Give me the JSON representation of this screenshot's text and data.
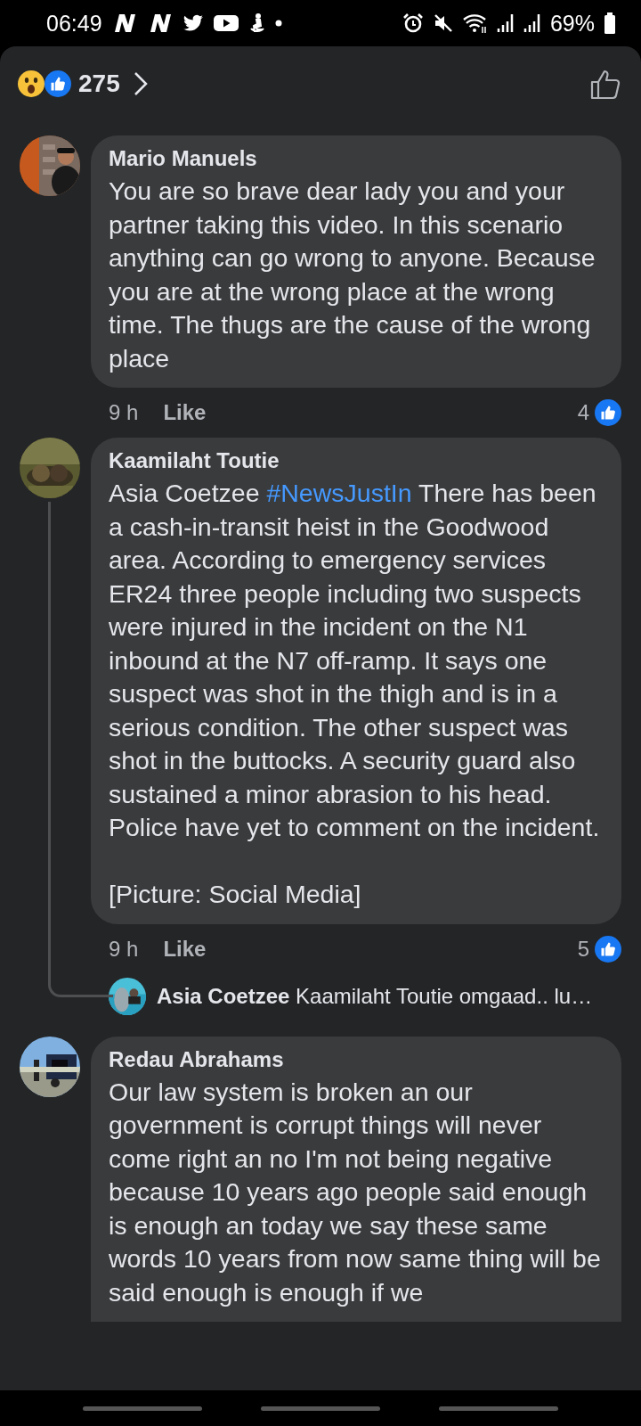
{
  "status_bar": {
    "time": "06:49",
    "battery": "69%"
  },
  "reactions": {
    "count": "275"
  },
  "comments": [
    {
      "author": "Mario Manuels",
      "body": [
        {
          "kind": "text",
          "text": "You are so brave dear lady you and your partner taking this video. In this scenario anything can go wrong to anyone. Because you are at the wrong place at the wrong time. The thugs are the cause of the wrong place"
        }
      ],
      "time": "9 h",
      "like": "Like",
      "like_count": "4"
    },
    {
      "author": "Kaamilaht Toutie",
      "body": [
        {
          "kind": "text",
          "text": "Asia Coetzee "
        },
        {
          "kind": "hashtag",
          "text": "#NewsJustIn"
        },
        {
          "kind": "text",
          "text": " There has been a cash-in-transit heist in the Goodwood area. According to emergency services ER24 three people including two suspects were injured in the incident on the N1 inbound at the N7 off-ramp. It says one suspect was shot in the thigh and is in a serious condition. The other suspect was shot in the buttocks. A security guard also sustained a minor abrasion to his head. Police have yet to comment on the incident.\n\n[Picture: Social Media]"
        }
      ],
      "time": "9 h",
      "like": "Like",
      "like_count": "5",
      "reply": {
        "author": "Asia Coetzee",
        "text": "Kaamilaht Toutie omgaad.. lu…"
      }
    },
    {
      "author": "Redau Abrahams",
      "body": [
        {
          "kind": "text",
          "text": "Our law system is broken an our government is corrupt things will never come right an no I'm not being negative because 10 years ago people said enough is enough an today we say these same words 10 years from now same thing will be said enough is enough if we"
        }
      ]
    }
  ]
}
